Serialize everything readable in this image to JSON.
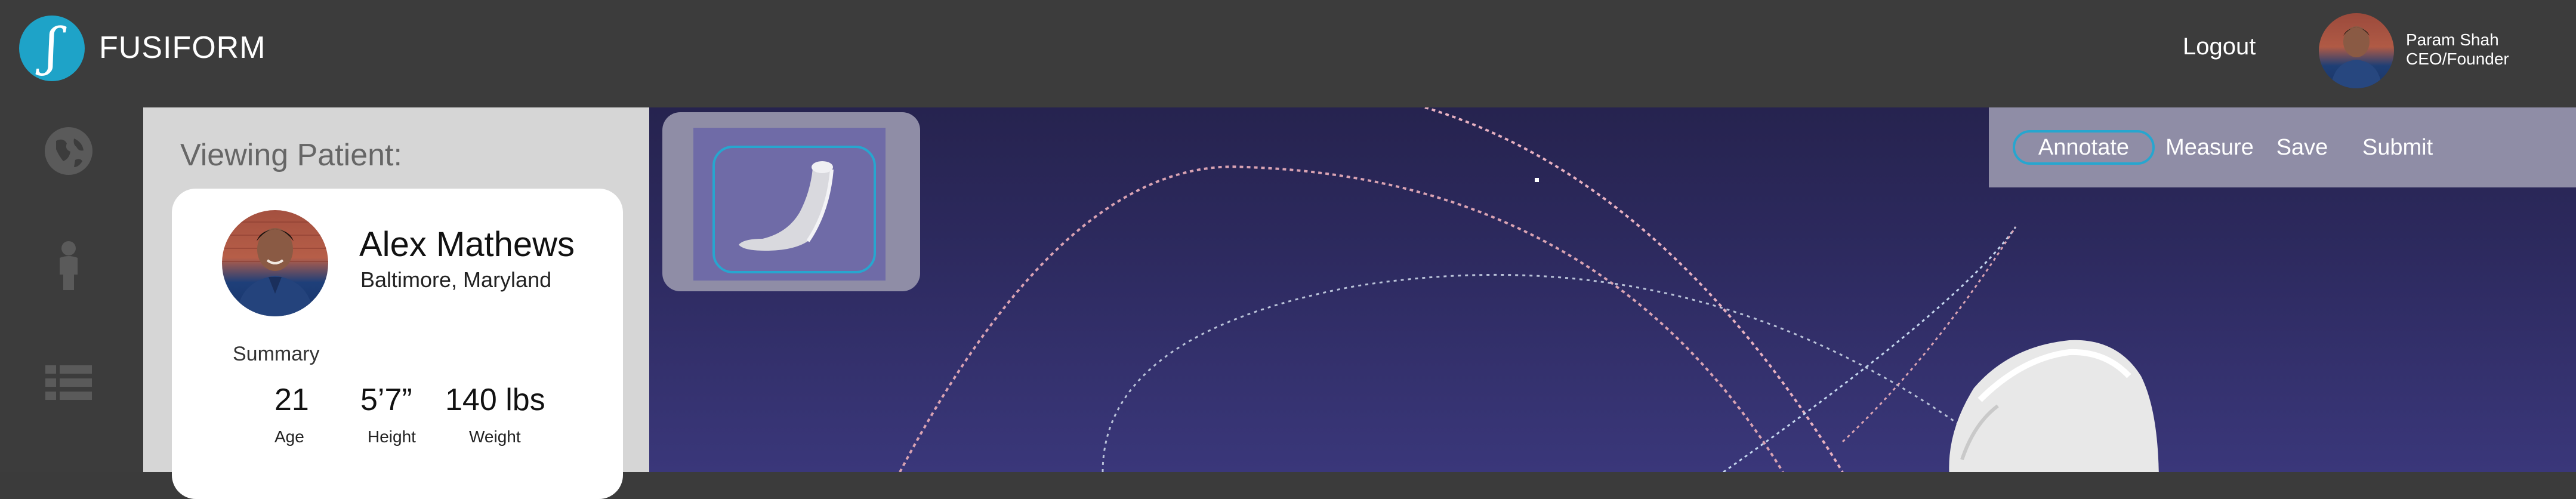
{
  "header": {
    "brand": "FUSIFORM",
    "logo_glyph": "ʃ",
    "logout_label": "Logout",
    "user": {
      "name": "Param Shah",
      "role": "CEO/Founder"
    }
  },
  "sidebar": {
    "items": [
      {
        "icon": "globe-icon"
      },
      {
        "icon": "person-icon"
      },
      {
        "icon": "list-icon"
      }
    ]
  },
  "patient_panel": {
    "heading": "Viewing Patient:",
    "patient": {
      "name": "Alex Mathews",
      "location": "Baltimore, Maryland"
    },
    "summary_label": "Summary",
    "stats": [
      {
        "value": "21",
        "label": "Age"
      },
      {
        "value": "5’7”",
        "label": "Height"
      },
      {
        "value": "140 lbs",
        "label": "Weight"
      }
    ]
  },
  "viewport": {
    "thumbnail_icon": "leg-model-icon"
  },
  "toolbar": {
    "tools": [
      {
        "label": "Annotate",
        "active": true
      },
      {
        "label": "Measure",
        "active": false
      },
      {
        "label": "Save",
        "active": false
      },
      {
        "label": "Submit",
        "active": false
      }
    ]
  },
  "colors": {
    "accent": "#27a6cf",
    "logo": "#1ea3c8",
    "topbar": "#3c3c3c",
    "panel": "#d6d6d6",
    "toolbar": "#8f8da6",
    "viewport": "#2d2a5f"
  }
}
